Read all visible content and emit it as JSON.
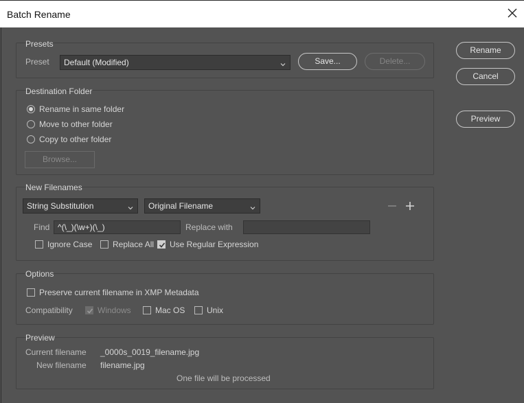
{
  "window": {
    "title": "Batch Rename"
  },
  "buttons": {
    "rename": "Rename",
    "cancel": "Cancel",
    "preview": "Preview"
  },
  "presets": {
    "group_title": "Presets",
    "preset_label": "Preset",
    "preset_value": "Default (Modified)",
    "save_label": "Save...",
    "delete_label": "Delete..."
  },
  "destination": {
    "group_title": "Destination Folder",
    "options": [
      {
        "label": "Rename in same folder",
        "selected": true
      },
      {
        "label": "Move to other folder",
        "selected": false
      },
      {
        "label": "Copy to other folder",
        "selected": false
      }
    ],
    "browse_label": "Browse..."
  },
  "new_filenames": {
    "group_title": "New Filenames",
    "type_select": "String Substitution",
    "source_select": "Original Filename",
    "minus_icon": "minus-icon",
    "plus_icon": "plus-icon",
    "find_label": "Find",
    "find_value": "^(\\_)(\\w+)(\\_)",
    "replace_label": "Replace with",
    "replace_value": "",
    "ignore_case": {
      "label": "Ignore Case",
      "checked": false
    },
    "replace_all": {
      "label": "Replace All",
      "checked": false
    },
    "use_regex": {
      "label": "Use Regular Expression",
      "checked": true
    }
  },
  "options": {
    "group_title": "Options",
    "preserve_label": "Preserve current filename in XMP Metadata",
    "preserve_checked": false,
    "compat_label": "Compatibility",
    "windows": {
      "label": "Windows",
      "checked": true,
      "disabled": true
    },
    "macos": {
      "label": "Mac OS",
      "checked": false
    },
    "unix": {
      "label": "Unix",
      "checked": false
    }
  },
  "preview": {
    "group_title": "Preview",
    "current_label": "Current filename",
    "current_value": "_0000s_0019_filename.jpg",
    "new_label": "New filename",
    "new_value": "filename.jpg",
    "summary": "One file will be processed"
  }
}
